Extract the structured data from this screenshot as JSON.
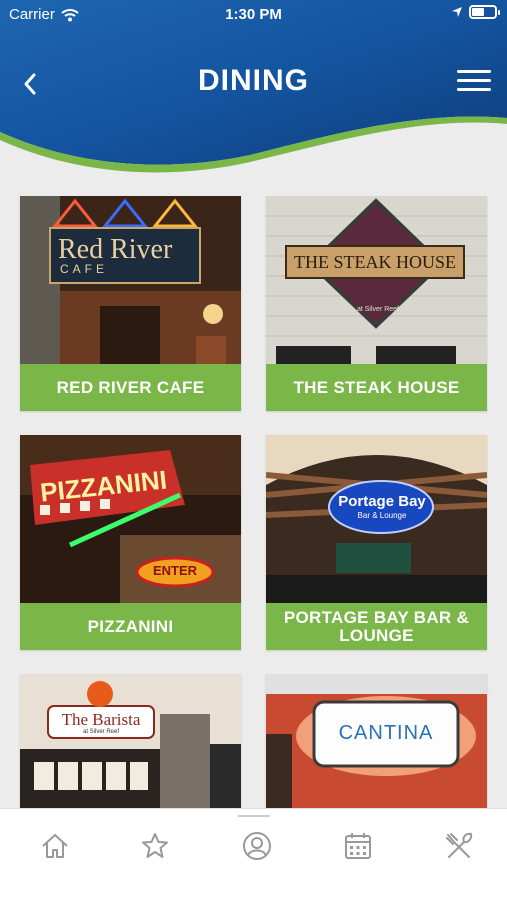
{
  "status": {
    "carrier": "Carrier",
    "time": "1:30 PM",
    "battery_level": 0.55
  },
  "header": {
    "title": "DINING",
    "back_icon": "chevron-left-icon",
    "menu_icon": "hamburger-menu-icon",
    "colors": {
      "blue_dark": "#0f3d7a",
      "blue_light": "#1e66b0",
      "green_wave": "#7ab648"
    }
  },
  "restaurants": [
    {
      "label": "RED RIVER CAFE",
      "sign": "Red River",
      "sign_sub": "CAFE"
    },
    {
      "label": "THE STEAK HOUSE",
      "sign": "THE STEAK HOUSE",
      "sign_sub": "at Silver Reef"
    },
    {
      "label": "PIZZANINI",
      "sign": "PIZZANINI",
      "sign_sub": "ENTER"
    },
    {
      "label": "PORTAGE BAY BAR & LOUNGE",
      "sign": "Portage Bay",
      "sign_sub": "Bar & Lounge"
    },
    {
      "label": "",
      "sign": "The Barista",
      "sign_sub": "at Silver Reef"
    },
    {
      "label": "",
      "sign": "CANTINA",
      "sign_sub": ""
    }
  ],
  "tabbar": {
    "items": [
      "home-icon",
      "star-icon",
      "profile-icon",
      "calendar-icon",
      "dining-utensils-icon"
    ]
  }
}
